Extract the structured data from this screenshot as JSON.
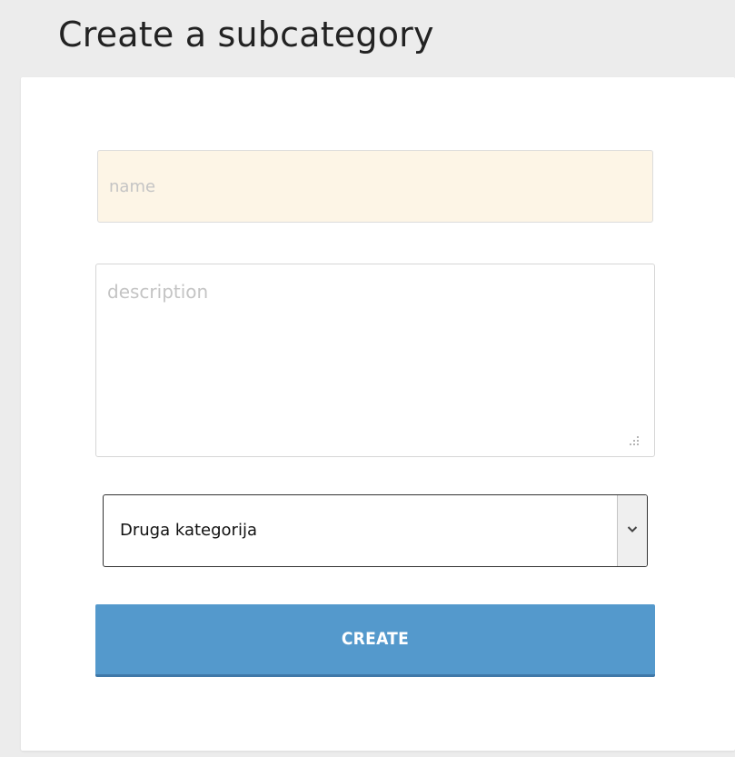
{
  "page": {
    "title": "Create a subcategory"
  },
  "form": {
    "name_placeholder": "name",
    "name_value": "",
    "description_placeholder": "description",
    "description_value": "",
    "category_selected": "Druga kategorija",
    "submit_label": "CREATE"
  },
  "icons": {
    "resize_grip": "resize-grip-icon",
    "select_arrow": "chevron-down-icon"
  },
  "colors": {
    "page_background": "#ececec",
    "card_background": "#ffffff",
    "name_field_background": "#fdf5e6",
    "button_background": "#5499cc",
    "button_text": "#ffffff"
  }
}
